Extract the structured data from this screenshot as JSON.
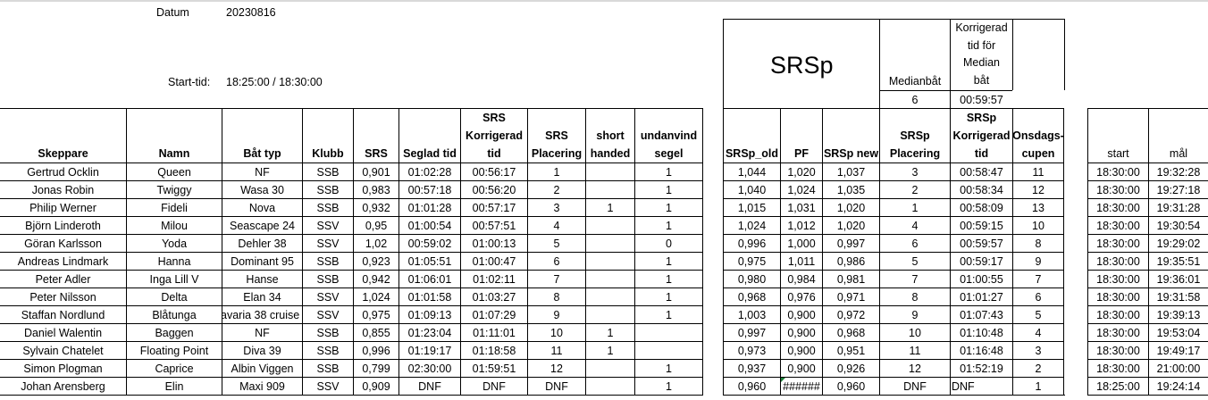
{
  "datum_label": "Datum",
  "datum_value": "20230816",
  "start_label": "Start-tid:",
  "start_value": "18:25:00 / 18:30:00",
  "srsp_title": "SRSp",
  "median": {
    "label": "Medianbåt",
    "value": "6",
    "korr_lines": [
      "Korrigerad",
      "tid för",
      "Median",
      "båt"
    ],
    "korr_value": "00:59:57"
  },
  "headers": {
    "skeppare": "Skeppare",
    "namn": "Namn",
    "battyp": "Båt typ",
    "klubb": "Klubb",
    "srs": "SRS",
    "seglad": "Seglad tid",
    "srs_korr": [
      "SRS",
      "Korrigerad",
      "tid"
    ],
    "srs_plac": [
      "SRS",
      "Placering"
    ],
    "short": [
      "short",
      "handed"
    ],
    "undanvind": [
      "undanvind",
      "segel"
    ],
    "srsp_old": "SRSp_old",
    "pf": "PF",
    "srsp_new": "SRSp new",
    "srsp_plac": [
      "SRSp",
      "Placering"
    ],
    "srsp_korr": [
      "SRSp",
      "Korrigerad",
      "tid"
    ],
    "onsdags": [
      "Onsdags-",
      "cupen"
    ],
    "start": "start",
    "mal": "mål"
  },
  "rows": [
    {
      "skeppare": "Gertrud Ocklin",
      "namn": "Queen",
      "battyp": "NF",
      "klubb": "SSB",
      "srs": "0,901",
      "seglad": "01:02:28",
      "srs_korr": "00:56:17",
      "srs_plac": "1",
      "short": "",
      "undanvind": "1",
      "srsp_old": "1,044",
      "pf": "1,020",
      "srsp_new": "1,037",
      "srsp_plac": "3",
      "srsp_korr": "00:58:47",
      "onsdags": "11",
      "start": "18:30:00",
      "mal": "19:32:28"
    },
    {
      "skeppare": "Jonas Robin",
      "namn": "Twiggy",
      "battyp": "Wasa 30",
      "klubb": "SSB",
      "srs": "0,983",
      "seglad": "00:57:18",
      "srs_korr": "00:56:20",
      "srs_plac": "2",
      "short": "",
      "undanvind": "1",
      "srsp_old": "1,040",
      "pf": "1,024",
      "srsp_new": "1,035",
      "srsp_plac": "2",
      "srsp_korr": "00:58:34",
      "onsdags": "12",
      "start": "18:30:00",
      "mal": "19:27:18"
    },
    {
      "skeppare": "Philip Werner",
      "namn": "Fideli",
      "battyp": "Nova",
      "klubb": "SSB",
      "srs": "0,932",
      "seglad": "01:01:28",
      "srs_korr": "00:57:17",
      "srs_plac": "3",
      "short": "1",
      "undanvind": "1",
      "srsp_old": "1,015",
      "pf": "1,031",
      "srsp_new": "1,020",
      "srsp_plac": "1",
      "srsp_korr": "00:58:09",
      "onsdags": "13",
      "start": "18:30:00",
      "mal": "19:31:28"
    },
    {
      "skeppare": "Björn Linderoth",
      "namn": "Milou",
      "battyp": "Seascape 24",
      "klubb": "SSV",
      "srs": "0,95",
      "seglad": "01:00:54",
      "srs_korr": "00:57:51",
      "srs_plac": "4",
      "short": "",
      "undanvind": "1",
      "srsp_old": "1,024",
      "pf": "1,012",
      "srsp_new": "1,020",
      "srsp_plac": "4",
      "srsp_korr": "00:59:15",
      "onsdags": "10",
      "start": "18:30:00",
      "mal": "19:30:54"
    },
    {
      "skeppare": "Göran Karlsson",
      "namn": "Yoda",
      "battyp": "Dehler 38",
      "klubb": "SSV",
      "srs": "1,02",
      "seglad": "00:59:02",
      "srs_korr": "01:00:13",
      "srs_plac": "5",
      "short": "",
      "undanvind": "0",
      "srsp_old": "0,996",
      "pf": "1,000",
      "srsp_new": "0,997",
      "srsp_plac": "6",
      "srsp_korr": "00:59:57",
      "onsdags": "8",
      "start": "18:30:00",
      "mal": "19:29:02"
    },
    {
      "skeppare": "Andreas Lindmark",
      "namn": "Hanna",
      "battyp": "Dominant 95",
      "klubb": "SSB",
      "srs": "0,923",
      "seglad": "01:05:51",
      "srs_korr": "01:00:47",
      "srs_plac": "6",
      "short": "",
      "undanvind": "1",
      "srsp_old": "0,975",
      "pf": "1,011",
      "srsp_new": "0,986",
      "srsp_plac": "5",
      "srsp_korr": "00:59:17",
      "onsdags": "9",
      "start": "18:30:00",
      "mal": "19:35:51"
    },
    {
      "skeppare": "Peter Adler",
      "namn": "Inga Lill V",
      "battyp": "Hanse",
      "klubb": "SSB",
      "srs": "0,942",
      "seglad": "01:06:01",
      "srs_korr": "01:02:11",
      "srs_plac": "7",
      "short": "",
      "undanvind": "1",
      "srsp_old": "0,980",
      "pf": "0,984",
      "srsp_new": "0,981",
      "srsp_plac": "7",
      "srsp_korr": "01:00:55",
      "onsdags": "7",
      "start": "18:30:00",
      "mal": "19:36:01"
    },
    {
      "skeppare": "Peter Nilsson",
      "namn": "Delta",
      "battyp": "Elan 34",
      "klubb": "SSV",
      "srs": "1,024",
      "seglad": "01:01:58",
      "srs_korr": "01:03:27",
      "srs_plac": "8",
      "short": "",
      "undanvind": "1",
      "srsp_old": "0,968",
      "pf": "0,976",
      "srsp_new": "0,971",
      "srsp_plac": "8",
      "srsp_korr": "01:01:27",
      "onsdags": "6",
      "start": "18:30:00",
      "mal": "19:31:58"
    },
    {
      "skeppare": "Staffan Nordlund",
      "namn": "Blåtunga",
      "battyp": "avaria 38 cruise",
      "klubb": "SSV",
      "srs": "0,975",
      "seglad": "01:09:13",
      "srs_korr": "01:07:29",
      "srs_plac": "9",
      "short": "",
      "undanvind": "1",
      "srsp_old": "1,003",
      "pf": "0,900",
      "srsp_new": "0,972",
      "srsp_plac": "9",
      "srsp_korr": "01:07:43",
      "onsdags": "5",
      "start": "18:30:00",
      "mal": "19:39:13"
    },
    {
      "skeppare": "Daniel Walentin",
      "namn": "Baggen",
      "battyp": "NF",
      "klubb": "SSB",
      "srs": "0,855",
      "seglad": "01:23:04",
      "srs_korr": "01:11:01",
      "srs_plac": "10",
      "short": "1",
      "undanvind": "",
      "srsp_old": "0,997",
      "pf": "0,900",
      "srsp_new": "0,968",
      "srsp_plac": "10",
      "srsp_korr": "01:10:48",
      "onsdags": "4",
      "start": "18:30:00",
      "mal": "19:53:04"
    },
    {
      "skeppare": "Sylvain Chatelet",
      "namn": "Floating Point",
      "battyp": "Diva 39",
      "klubb": "SSB",
      "srs": "0,996",
      "seglad": "01:19:17",
      "srs_korr": "01:18:58",
      "srs_plac": "11",
      "short": "1",
      "undanvind": "",
      "srsp_old": "0,973",
      "pf": "0,900",
      "srsp_new": "0,951",
      "srsp_plac": "11",
      "srsp_korr": "01:16:48",
      "onsdags": "3",
      "start": "18:30:00",
      "mal": "19:49:17"
    },
    {
      "skeppare": "Simon Plogman",
      "namn": "Caprice",
      "battyp": "Albin Viggen",
      "klubb": "SSB",
      "srs": "0,799",
      "seglad": "02:30:00",
      "srs_korr": "01:59:51",
      "srs_plac": "12",
      "short": "",
      "undanvind": "1",
      "srsp_old": "0,937",
      "pf": "0,900",
      "srsp_new": "0,926",
      "srsp_plac": "12",
      "srsp_korr": "01:52:19",
      "onsdags": "2",
      "start": "18:30:00",
      "mal": "21:00:00"
    },
    {
      "skeppare": "Johan Arensberg",
      "namn": "Elin",
      "battyp": "Maxi 909",
      "klubb": "SSV",
      "srs": "0,909",
      "seglad": "DNF",
      "srs_korr": "DNF",
      "srs_plac": "DNF",
      "short": "",
      "undanvind": "1",
      "srsp_old": "0,960",
      "pf": "######",
      "srsp_new": "0,960",
      "srsp_plac": "DNF",
      "srsp_korr": "DNF",
      "onsdags": "1",
      "start": "18:25:00",
      "mal": "19:24:14"
    }
  ]
}
